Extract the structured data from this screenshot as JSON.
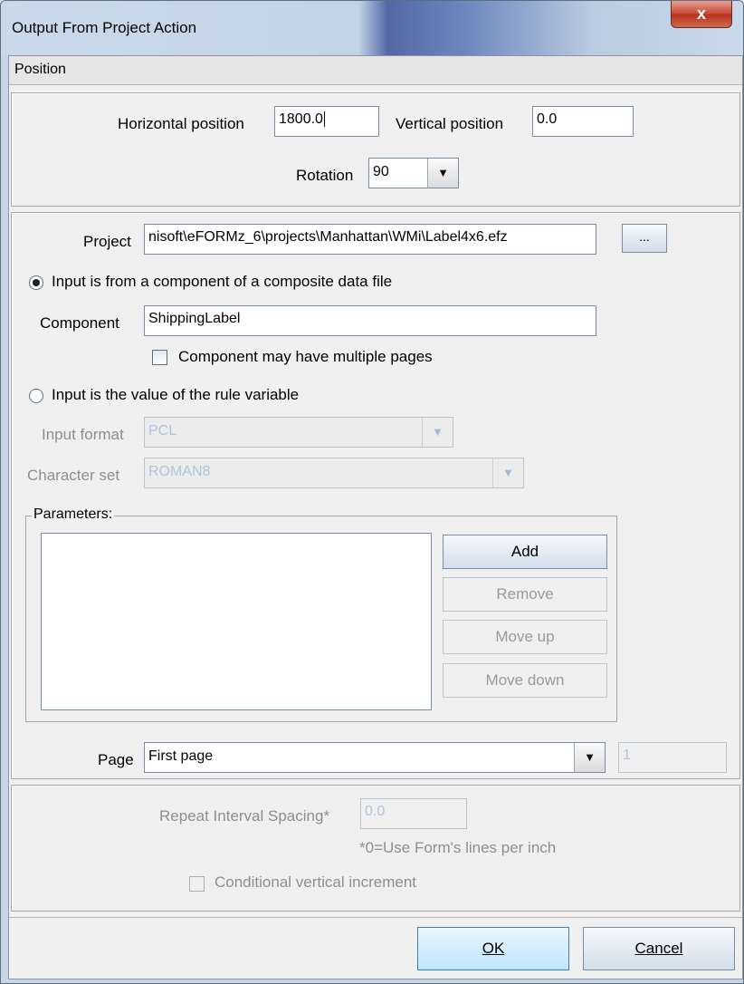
{
  "window": {
    "title": "Output From Project Action",
    "close_label": "x"
  },
  "tab": {
    "label": "Position"
  },
  "position": {
    "horizontal_label": "Horizontal position",
    "horizontal_value": "1800.0",
    "vertical_label": "Vertical position",
    "vertical_value": "0.0",
    "rotation_label": "Rotation",
    "rotation_value": "90"
  },
  "source": {
    "project_label": "Project",
    "project_value": "nisoft\\eFORMz_6\\projects\\Manhattan\\WMi\\Label4x6.efz",
    "browse_label": "...",
    "radio_component_label": "Input is from a component of a composite data file",
    "component_label": "Component",
    "component_value": "ShippingLabel",
    "multi_pages_label": "Component may have multiple pages",
    "radio_rule_label": "Input is the value of the rule variable",
    "input_format_label": "Input format",
    "input_format_value": "PCL",
    "charset_label": "Character set",
    "charset_value": "ROMAN8",
    "parameters_label": "Parameters:",
    "add_label": "Add",
    "remove_label": "Remove",
    "move_up_label": "Move up",
    "move_down_label": "Move down",
    "page_label": "Page",
    "page_value": "First page",
    "page_number_value": "1"
  },
  "repeat": {
    "spacing_label": "Repeat Interval Spacing*",
    "spacing_value": "0.0",
    "note": "*0=Use Form's lines per inch",
    "conditional_label": "Conditional vertical increment"
  },
  "footer": {
    "ok_label": "OK",
    "cancel_label": "Cancel"
  }
}
